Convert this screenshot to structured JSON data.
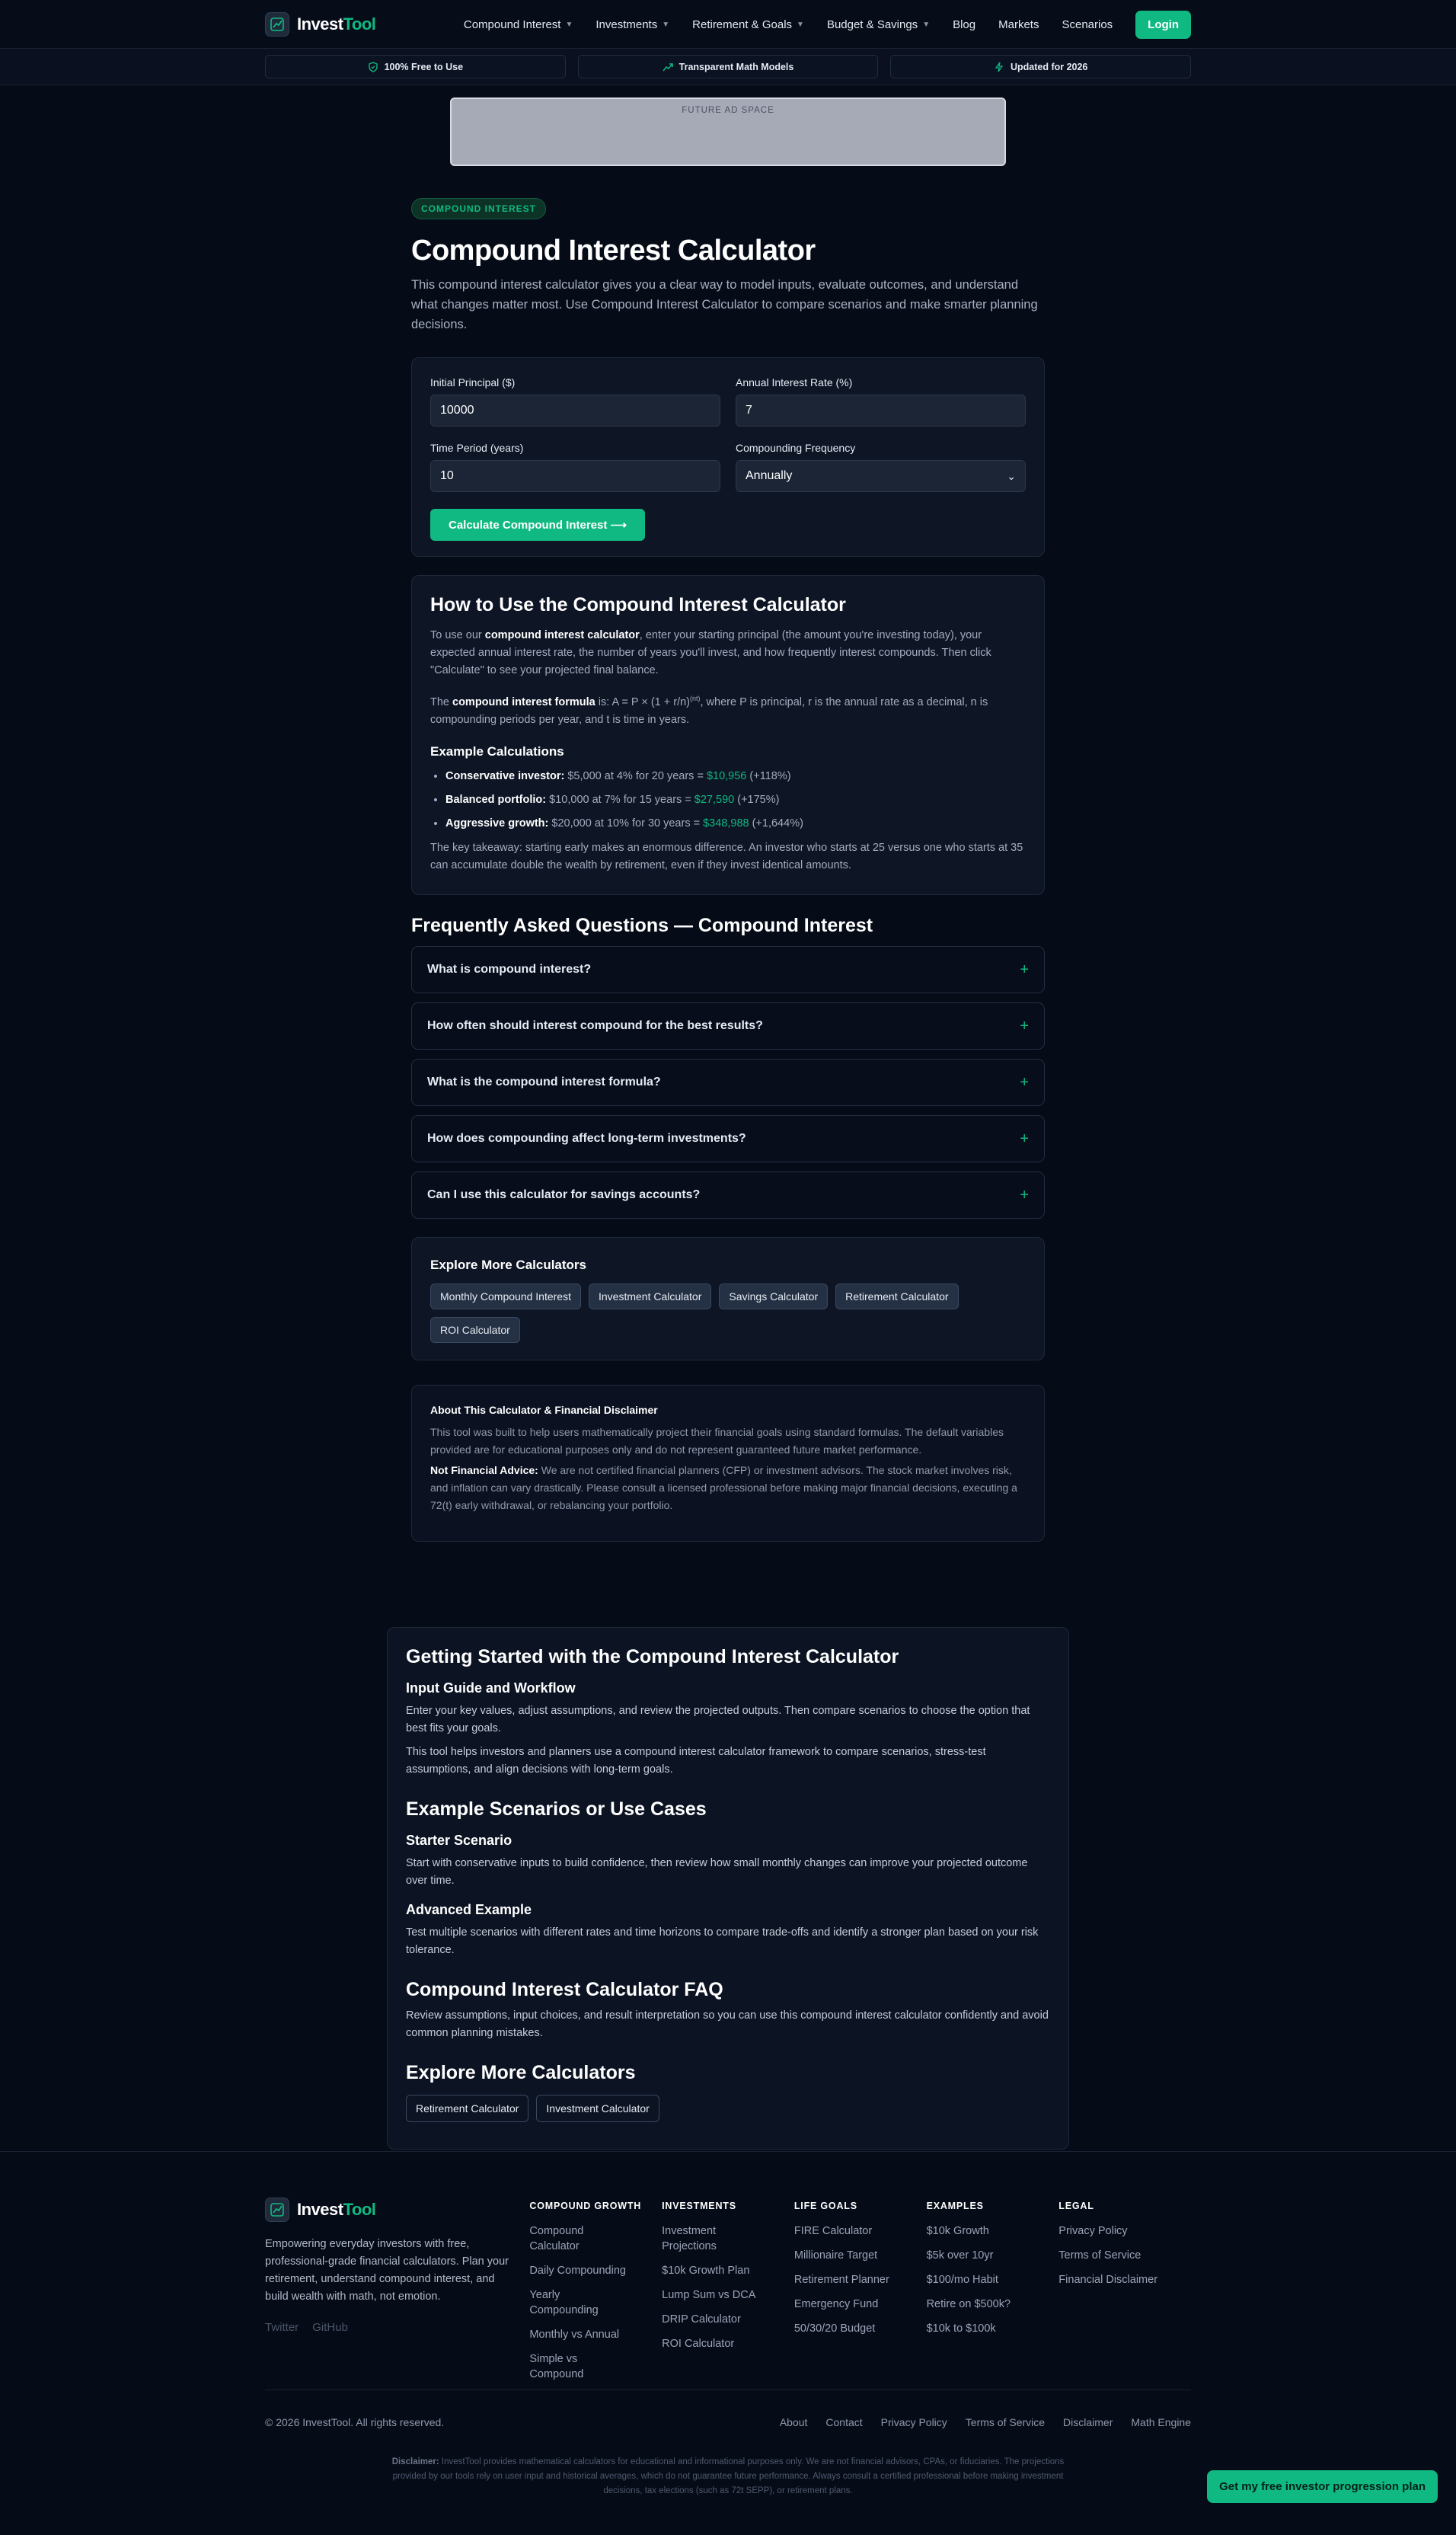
{
  "nav": {
    "brand_a": "Invest",
    "brand_b": "Tool",
    "links": [
      "Compound Interest",
      "Investments",
      "Retirement & Goals",
      "Budget & Savings",
      "Blog",
      "Markets",
      "Scenarios"
    ],
    "login": "Login"
  },
  "trust": [
    "100% Free to Use",
    "Transparent Math Models",
    "Updated for 2026"
  ],
  "ad_label": "FUTURE AD SPACE",
  "hero": {
    "pill": "COMPOUND INTEREST",
    "title": "Compound Interest Calculator",
    "lead": "This compound interest calculator gives you a clear way to model inputs, evaluate outcomes, and understand what changes matter most. Use Compound Interest Calculator to compare scenarios and make smarter planning decisions."
  },
  "calc": {
    "principal_label": "Initial Principal ($)",
    "principal_value": "10000",
    "rate_label": "Annual Interest Rate (%)",
    "rate_value": "7",
    "years_label": "Time Period (years)",
    "years_value": "10",
    "freq_label": "Compounding Frequency",
    "freq_value": "Annually",
    "button": "Calculate Compound Interest ⟶"
  },
  "howto": {
    "title": "How to Use the Compound Interest Calculator",
    "p1_a": "To use our ",
    "p1_b": "compound interest calculator",
    "p1_c": ", enter your starting principal (the amount you're investing today), your expected annual interest rate, the number of years you'll invest, and how frequently interest compounds. Then click \"Calculate\" to see your projected final balance.",
    "p2_a": "The ",
    "p2_b": "compound interest formula",
    "p2_c": " is: A = P × (1 + r/n)",
    "p2_sup": "(nt)",
    "p2_d": ", where P is principal, r is the annual rate as a decimal, n is compounding periods per year, and t is time in years.",
    "examples_title": "Example Calculations",
    "examples": [
      {
        "label": "Conservative investor:",
        "text": " $5,000 at 4% for 20 years = ",
        "value": "$10,956",
        "pct": " (+118%)"
      },
      {
        "label": "Balanced portfolio:",
        "text": " $10,000 at 7% for 15 years = ",
        "value": "$27,590",
        "pct": " (+175%)"
      },
      {
        "label": "Aggressive growth:",
        "text": " $20,000 at 10% for 30 years = ",
        "value": "$348,988",
        "pct": " (+1,644%)"
      }
    ],
    "takeaway": "The key takeaway: starting early makes an enormous difference. An investor who starts at 25 versus one who starts at 35 can accumulate double the wealth by retirement, even if they invest identical amounts."
  },
  "faq": {
    "title": "Frequently Asked Questions — Compound Interest",
    "items": [
      "What is compound interest?",
      "How often should interest compound for the best results?",
      "What is the compound interest formula?",
      "How does compounding affect long-term investments?",
      "Can I use this calculator for savings accounts?"
    ]
  },
  "explore": {
    "title": "Explore More Calculators",
    "chips": [
      "Monthly Compound Interest",
      "Investment Calculator",
      "Savings Calculator",
      "Retirement Calculator",
      "ROI Calculator"
    ]
  },
  "disclaimer": {
    "title": "About This Calculator & Financial Disclaimer",
    "p1": "This tool was built to help users mathematically project their financial goals using standard formulas. The default variables provided are for educational purposes only and do not represent guaranteed future market performance.",
    "p2_b": "Not Financial Advice:",
    "p2": " We are not certified financial planners (CFP) or investment advisors. The stock market involves risk, and inflation can vary drastically. Please consult a licensed professional before making major financial decisions, executing a 72(t) early withdrawal, or rebalancing your portfolio."
  },
  "guide": {
    "title": "Getting Started with the Compound Interest Calculator",
    "h_input": "Input Guide and Workflow",
    "p_input1": "Enter your key values, adjust assumptions, and review the projected outputs. Then compare scenarios to choose the option that best fits your goals.",
    "p_input2": "This tool helps investors and planners use a compound interest calculator framework to compare scenarios, stress-test assumptions, and align decisions with long-term goals.",
    "h_examples": "Example Scenarios or Use Cases",
    "h_starter": "Starter Scenario",
    "p_starter": "Start with conservative inputs to build confidence, then review how small monthly changes can improve your projected outcome over time.",
    "h_advanced": "Advanced Example",
    "p_advanced": "Test multiple scenarios with different rates and time horizons to compare trade-offs and identify a stronger plan based on your risk tolerance.",
    "h_faq": "Compound Interest Calculator FAQ",
    "p_faq": "Review assumptions, input choices, and result interpretation so you can use this compound interest calculator confidently and avoid common planning mistakes.",
    "h_explore": "Explore More Calculators",
    "chips": [
      "Retirement Calculator",
      "Investment Calculator"
    ]
  },
  "footer": {
    "description": "Empowering everyday investors with free, professional-grade financial calculators. Plan your retirement, understand compound interest, and build wealth with math, not emotion.",
    "social": [
      "Twitter",
      "GitHub"
    ],
    "columns": [
      {
        "title": "COMPOUND GROWTH",
        "links": [
          "Compound Calculator",
          "Daily Compounding",
          "Yearly Compounding",
          "Monthly vs Annual",
          "Simple vs Compound"
        ]
      },
      {
        "title": "INVESTMENTS",
        "links": [
          "Investment Projections",
          "$10k Growth Plan",
          "Lump Sum vs DCA",
          "DRIP Calculator",
          "ROI Calculator"
        ]
      },
      {
        "title": "LIFE GOALS",
        "links": [
          "FIRE Calculator",
          "Millionaire Target",
          "Retirement Planner",
          "Emergency Fund",
          "50/30/20 Budget"
        ]
      },
      {
        "title": "EXAMPLES",
        "links": [
          "$10k Growth",
          "$5k over 10yr",
          "$100/mo Habit",
          "Retire on $500k?",
          "$10k to $100k"
        ]
      },
      {
        "title": "LEGAL",
        "links": [
          "Privacy Policy",
          "Terms of Service",
          "Financial Disclaimer"
        ]
      }
    ],
    "copyright": "© 2026 InvestTool. All rights reserved.",
    "bottom_links": [
      "About",
      "Contact",
      "Privacy Policy",
      "Terms of Service",
      "Disclaimer",
      "Math Engine"
    ],
    "legal_b": "Disclaimer:",
    "legal": " InvestTool provides mathematical calculators for educational and informational purposes only. We are not financial advisors, CPAs, or fiduciaries. The projections provided by our tools rely on user input and historical averages, which do not guarantee future performance. Always consult a certified professional before making investment decisions, tax elections (such as 72t SEPP), or retirement plans.",
    "cta": "Get my free investor progression plan"
  },
  "colors": {
    "accent": "#10b981",
    "background": "#060b18",
    "card": "#0e1525"
  }
}
